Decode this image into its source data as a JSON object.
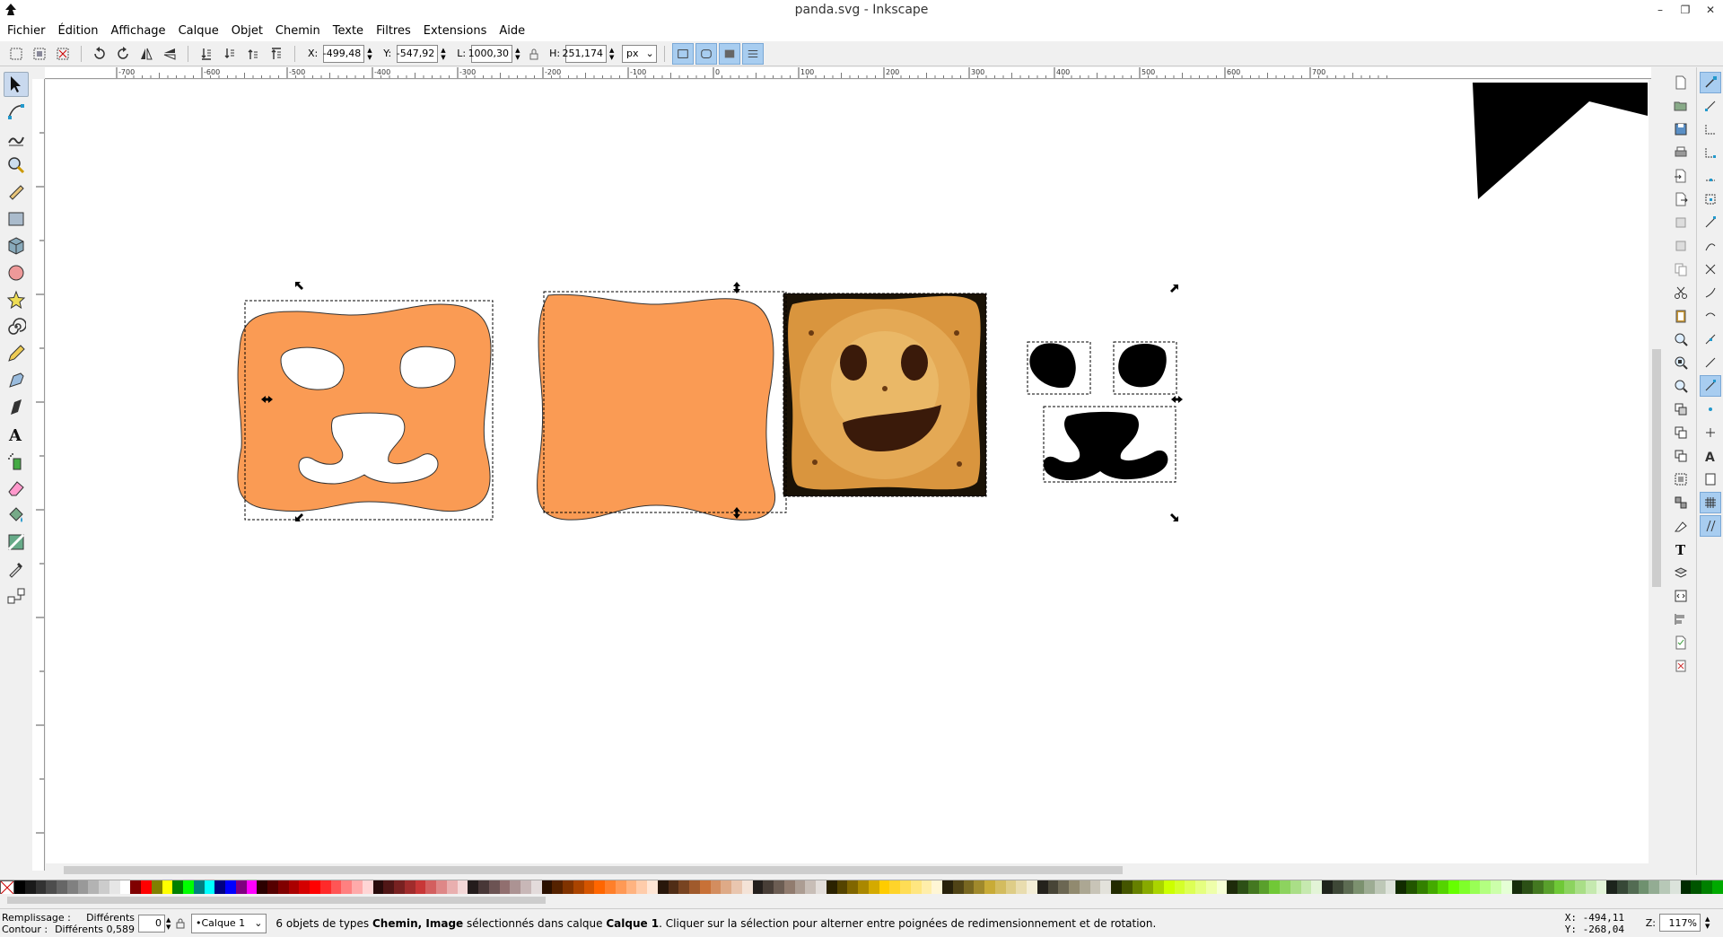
{
  "window": {
    "title": "panda.svg - Inkscape",
    "minimize": "–",
    "maximize": "❐",
    "close": "✕"
  },
  "menu": [
    "Fichier",
    "Édition",
    "Affichage",
    "Calque",
    "Objet",
    "Chemin",
    "Texte",
    "Filtres",
    "Extensions",
    "Aide"
  ],
  "toolbar": {
    "x_label": "X:",
    "x_value": "-499,48",
    "y_label": "Y:",
    "y_value": "-547,92",
    "w_label": "L:",
    "w_value": "1000,30",
    "h_label": "H:",
    "h_value": "251,174",
    "unit": "px"
  },
  "ruler": {
    "h_ticks": [
      "-700",
      "-600",
      "-500",
      "-400",
      "-300",
      "-200",
      "-100",
      "0",
      "100",
      "200",
      "300",
      "400",
      "500",
      "600",
      "700"
    ]
  },
  "canvas": {
    "shape_color": "#fa9b54",
    "selection_color": "#000000"
  },
  "statusbar": {
    "fill_label": "Remplissage :",
    "fill_value": "Différents",
    "stroke_label": "Contour :",
    "stroke_value": "Différents 0,589",
    "opacity_value": "0",
    "layer": "•Calque 1",
    "message_prefix": "6 objets de types ",
    "message_types": "Chemin, Image",
    "message_mid": " sélectionnés dans calque ",
    "message_layer": "Calque 1",
    "message_suffix": ". Cliquer sur la sélection pour alterner entre poignées de redimensionnement et de rotation.",
    "cursor_x": "X: -494,11",
    "cursor_y": "Y: -268,04",
    "zoom_label": "Z:",
    "zoom_value": "117%"
  },
  "palette": [
    "#000000",
    "#1a1a1a",
    "#333333",
    "#4d4d4d",
    "#666666",
    "#808080",
    "#999999",
    "#b3b3b3",
    "#cccccc",
    "#e6e6e6",
    "#ffffff",
    "#800000",
    "#ff0000",
    "#808000",
    "#ffff00",
    "#008000",
    "#00ff00",
    "#008080",
    "#00ffff",
    "#000080",
    "#0000ff",
    "#800080",
    "#ff00ff",
    "#2b0000",
    "#550000",
    "#800000",
    "#aa0000",
    "#d40000",
    "#ff0000",
    "#ff2a2a",
    "#ff5555",
    "#ff8080",
    "#ffaaaa",
    "#ffd5d5",
    "#280b0b",
    "#501616",
    "#782121",
    "#a02c2c",
    "#c83737",
    "#d35f5f",
    "#de8787",
    "#e9afaf",
    "#f4d7d7",
    "#241c1c",
    "#483737",
    "#6c5353",
    "#916f6f",
    "#ac9393",
    "#c8b7b7",
    "#e3dbdb",
    "#2b1100",
    "#552200",
    "#803300",
    "#aa4400",
    "#d45500",
    "#ff6600",
    "#ff7f2a",
    "#ff9955",
    "#ffb380",
    "#ffccaa",
    "#ffe6d5",
    "#28170b",
    "#502d16",
    "#784421",
    "#a05a2c",
    "#c87137",
    "#d38d5f",
    "#deaa87",
    "#e9c6af",
    "#f4e3d7",
    "#241f1c",
    "#483e37",
    "#6c5d53",
    "#917c6f",
    "#ac9d93",
    "#c8beb7",
    "#e3dedb",
    "#2b2200",
    "#554400",
    "#806600",
    "#aa8800",
    "#d4aa00",
    "#ffcc00",
    "#ffd42a",
    "#ffdd55",
    "#ffe680",
    "#ffeeaa",
    "#fff6d5",
    "#28220b",
    "#504416",
    "#786721",
    "#a0892c",
    "#c8ab37",
    "#d3bc5f",
    "#decd87",
    "#e9ddaf",
    "#f4eed7",
    "#24221c",
    "#484537",
    "#6c6753",
    "#918a6f",
    "#aca793",
    "#c8c4b7",
    "#e3e2db",
    "#222b00",
    "#445500",
    "#668000",
    "#88aa00",
    "#aad400",
    "#ccff00",
    "#d4ff2a",
    "#ddff55",
    "#e5ff80",
    "#eeffaa",
    "#f6ffd5",
    "#1e2b0b",
    "#2d5016",
    "#447821",
    "#5aa02c",
    "#71c837",
    "#8dd35f",
    "#aade87",
    "#c6e9af",
    "#e3f4d7",
    "#1f241c",
    "#3e4837",
    "#5d6c53",
    "#7c916f",
    "#9dac93",
    "#bec8b7",
    "#dee3db",
    "#112b00",
    "#225500",
    "#338000",
    "#44aa00",
    "#55d400",
    "#66ff00",
    "#7fff2a",
    "#99ff55",
    "#b3ff80",
    "#ccffaa",
    "#e5ffd5",
    "#162d0b",
    "#2c5016",
    "#437821",
    "#59a02c",
    "#6fc837",
    "#8cd35f",
    "#a9de87",
    "#c5e9af",
    "#e2f4d7",
    "#1c241c",
    "#374837",
    "#536c53",
    "#6f916f",
    "#93ac93",
    "#b7c8b7",
    "#dbe3db",
    "#002b00",
    "#005500",
    "#008000",
    "#00aa00"
  ]
}
